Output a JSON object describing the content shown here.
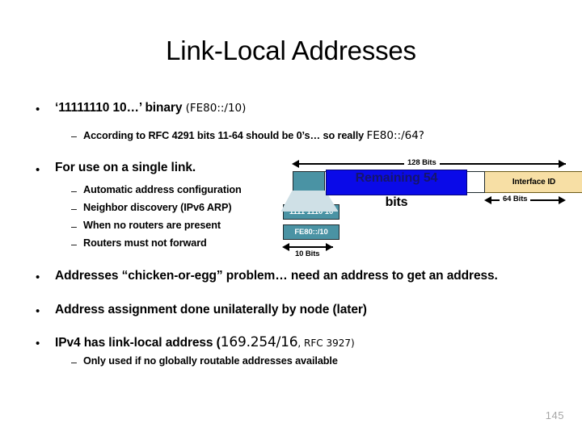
{
  "slide": {
    "title": "Link-Local Addresses",
    "page_number": "145"
  },
  "bullets": [
    {
      "text_prefix": "‘11111110 10…’ binary ",
      "text_alt": "(FE80::/10)",
      "sub": [
        {
          "text_prefix": "According to RFC 4291 bits 11-64 should be 0’s… so really ",
          "text_alt": "FE80::/64?"
        }
      ]
    },
    {
      "text_prefix": "For use on a single link.",
      "text_alt": "",
      "sub": [
        {
          "text_prefix": "Automatic address configuration",
          "text_alt": ""
        },
        {
          "text_prefix": "Neighbor discovery (IPv6 ARP)",
          "text_alt": ""
        },
        {
          "text_prefix": "When no routers are present",
          "text_alt": ""
        },
        {
          "text_prefix": "Routers must not forward",
          "text_alt": ""
        }
      ]
    },
    {
      "text_prefix": "Addresses “chicken-or-egg” problem… need an address to get an address.",
      "text_alt": "",
      "sub": []
    },
    {
      "text_prefix": "Address assignment done unilaterally by node (later)",
      "text_alt": "",
      "sub": []
    },
    {
      "text_prefix": "IPv4 has link-local address (",
      "text_big": "169.254/16",
      "text_alt": ", RFC 3927)",
      "sub": [
        {
          "text_prefix": "Only used if no globally routable addresses available",
          "text_alt": ""
        }
      ]
    }
  ],
  "bullet_glyph": "•",
  "sub_glyph": "–",
  "diagram": {
    "total_label": "128 Bits",
    "interface_id_label": "Interface ID",
    "interface_bits_label": "64 Bits",
    "remaining_label": "Remaining 54",
    "remaining_label_line2": "bits",
    "prefix_binary_label": "1111 1110 10",
    "prefix_hex_label": "FE80::/10",
    "prefix_bits_label": "10 Bits",
    "colors": {
      "teal": "#4a93a4",
      "blue": "#0a0ae8",
      "tan": "#f7dfa5",
      "connector": "#cfe0e6"
    }
  }
}
